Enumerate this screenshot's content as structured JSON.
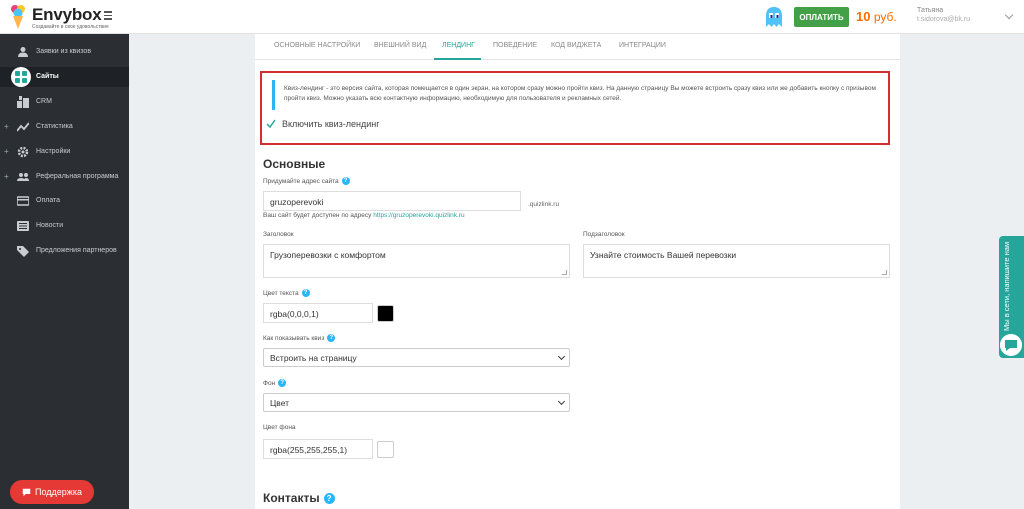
{
  "header": {
    "logo_name": "Envybox",
    "logo_tagline": "Создавайте в свое удовольствие",
    "pay_button": "ОПЛАТИТЬ",
    "balance_amount": "10",
    "balance_currency": "руб.",
    "user_name": "Татьяна",
    "user_email": "t.sidorova@bk.ru"
  },
  "sidebar": {
    "items": [
      {
        "label": "Заявки из квизов",
        "icon": "user-icon",
        "expandable": false,
        "active": false
      },
      {
        "label": "Сайты",
        "icon": "grid-icon",
        "expandable": false,
        "active": true
      },
      {
        "label": "CRM",
        "icon": "crm-icon",
        "expandable": false,
        "active": false
      },
      {
        "label": "Статистика",
        "icon": "trend-icon",
        "expandable": true,
        "active": false
      },
      {
        "label": "Настройки",
        "icon": "gear-icon",
        "expandable": true,
        "active": false
      },
      {
        "label": "Реферальная программа",
        "icon": "people-icon",
        "expandable": true,
        "active": false
      },
      {
        "label": "Оплата",
        "icon": "card-icon",
        "expandable": false,
        "active": false
      },
      {
        "label": "Новости",
        "icon": "news-icon",
        "expandable": false,
        "active": false
      },
      {
        "label": "Предложения партнеров",
        "icon": "tag-icon",
        "expandable": false,
        "active": false
      }
    ],
    "support_button": "Поддержка"
  },
  "tabs": [
    "ОСНОВНЫЕ НАСТРОЙКИ",
    "ВНЕШНИЙ ВИД",
    "ЛЕНДИНГ",
    "ПОВЕДЕНИЕ",
    "КОД ВИДЖЕТА",
    "ИНТЕГРАЦИИ"
  ],
  "active_tab": "ЛЕНДИНГ",
  "landing": {
    "info_text": "Квиз-лендинг - это версия сайта, которая помещается в один экран, на котором сразу можно пройти квиз. На данную страницу Вы можете встроить сразу квиз или же добавить кнопку с призывом пройти квиз. Можно указать всю контактную информацию, необходимую для пользователя и рекламных сетей.",
    "enable_label": "Включить квиз-лендинг",
    "enabled": true
  },
  "main_section": {
    "title": "Основные",
    "site_address_label": "Придумайте адрес сайта",
    "site_address_value": "gruzoperevoki",
    "site_address_suffix": ".quizlink.ru",
    "site_hint_prefix": "Ваш сайт будет доступен по адресу",
    "site_hint_link": "https://gruzoperevoki.quizlink.ru",
    "heading_label": "Заголовок",
    "heading_value": "Грузоперевозки с комфортом",
    "subheading_label": "Подзаголовок",
    "subheading_value": "Узнайте стоимость Вашей перевозки",
    "text_color_label": "Цвет текста",
    "text_color_value": "rgba(0,0,0,1)",
    "text_color_swatch": "#000000",
    "show_quiz_label": "Как показывать квиз",
    "show_quiz_value": "Встроить на страницу",
    "background_label": "Фон",
    "background_value": "Цвет",
    "bg_color_label": "Цвет фона",
    "bg_color_value": "rgba(255,255,255,1)",
    "bg_color_swatch": "#ffffff"
  },
  "contacts_section": {
    "title": "Контакты"
  },
  "chat_widget": {
    "text": "Мы в сети, напишите нам"
  },
  "colors": {
    "accent": "#26a69a",
    "pay_green": "#43a047",
    "balance_orange": "#ff6d00",
    "highlight_red": "#d32f2f",
    "support_red": "#e53935",
    "sidebar_bg": "#2b2f33"
  }
}
